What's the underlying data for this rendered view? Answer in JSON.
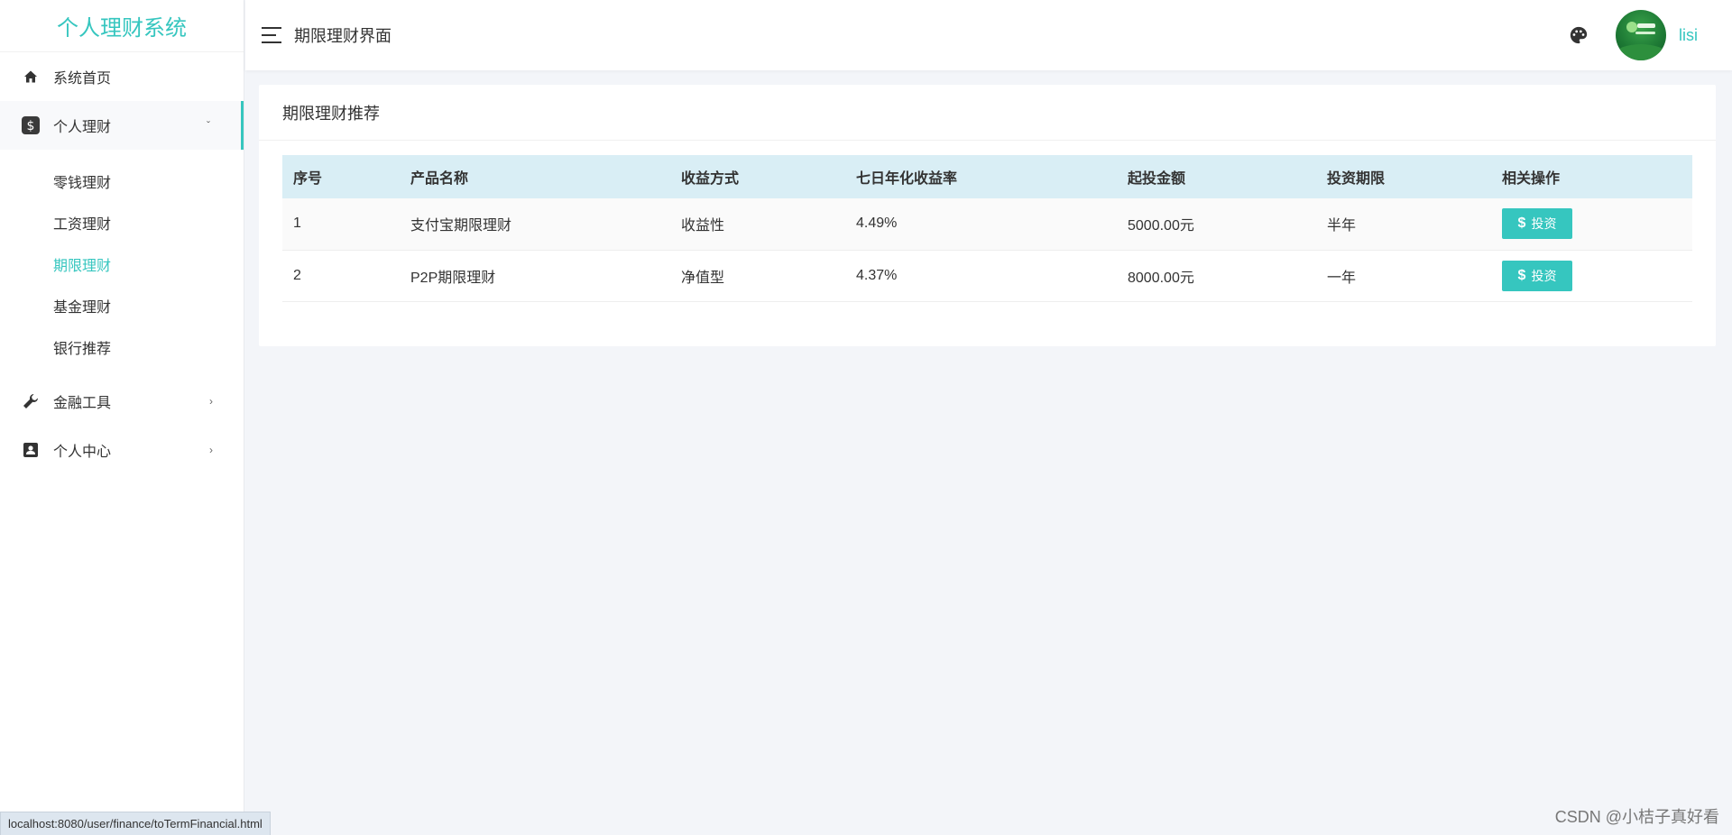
{
  "sidebar": {
    "logo": "个人理财系统",
    "items": [
      {
        "label": "系统首页",
        "icon": "home-icon"
      },
      {
        "label": "个人理财",
        "icon": "dollar-icon",
        "open": true
      },
      {
        "label": "金融工具",
        "icon": "wrench-icon"
      },
      {
        "label": "个人中心",
        "icon": "user-card-icon"
      }
    ],
    "submenu": [
      "零钱理财",
      "工资理财",
      "期限理财",
      "基金理财",
      "银行推荐"
    ],
    "active_sub": "期限理财"
  },
  "header": {
    "title": "期限理财界面",
    "username": "lisi"
  },
  "card": {
    "title": "期限理财推荐",
    "columns": [
      "序号",
      "产品名称",
      "收益方式",
      "七日年化收益率",
      "起投金额",
      "投资期限",
      "相关操作"
    ],
    "rows": [
      {
        "id": "1",
        "name": "支付宝期限理财",
        "type": "收益性",
        "rate": "4.49%",
        "min": "5000.00元",
        "term": "半年",
        "action": "投资"
      },
      {
        "id": "2",
        "name": "P2P期限理财",
        "type": "净值型",
        "rate": "4.37%",
        "min": "8000.00元",
        "term": "一年",
        "action": "投资"
      }
    ]
  },
  "statusbar": "localhost:8080/user/finance/toTermFinancial.html",
  "watermark": "CSDN @小桔子真好看",
  "colors": {
    "accent": "#36c6bf",
    "table_header": "#d9eef5"
  }
}
